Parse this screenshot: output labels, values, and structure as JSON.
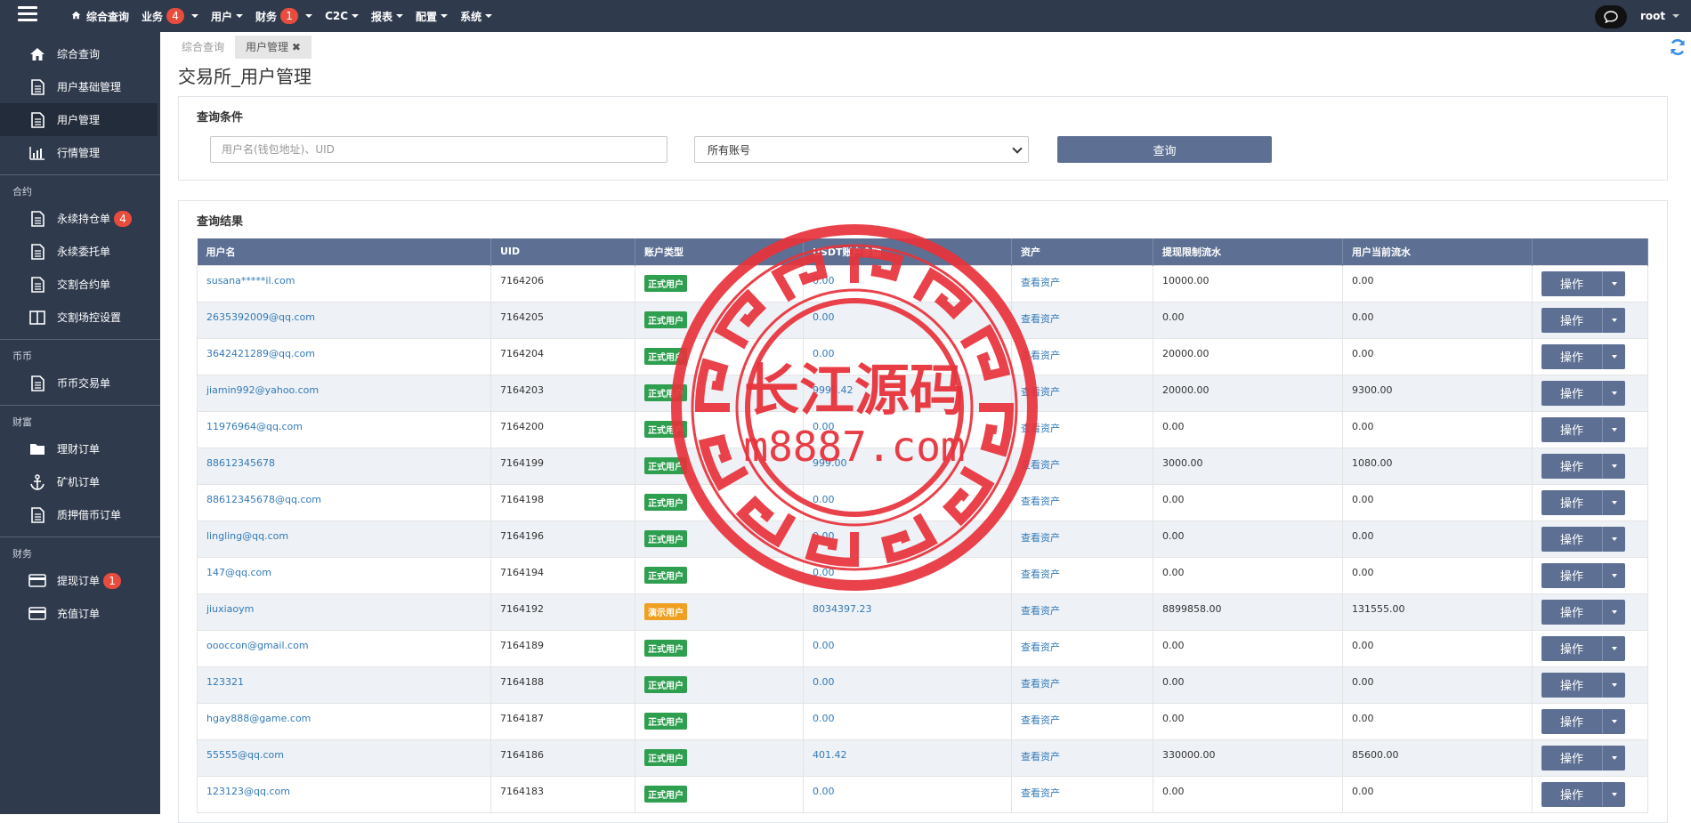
{
  "topbar": {
    "nav": [
      {
        "label": "综合查询",
        "icon": "home-icon"
      },
      {
        "label": "业务",
        "badge": "4",
        "dropdown": true
      },
      {
        "label": "用户",
        "dropdown": true
      },
      {
        "label": "财务",
        "badge": "1",
        "dropdown": true
      },
      {
        "label": "C2C",
        "dropdown": true
      },
      {
        "label": "报表",
        "dropdown": true
      },
      {
        "label": "配置",
        "dropdown": true
      },
      {
        "label": "系统",
        "dropdown": true
      }
    ],
    "user": "root"
  },
  "sidebar": {
    "groups": [
      {
        "title": "",
        "items": [
          {
            "label": "综合查询",
            "icon": "home-icon"
          },
          {
            "label": "用户基础管理",
            "icon": "document-icon"
          },
          {
            "label": "用户管理",
            "icon": "document-icon",
            "active": true
          },
          {
            "label": "行情管理",
            "icon": "bar-chart-icon"
          }
        ]
      },
      {
        "title": "合约",
        "items": [
          {
            "label": "永续持仓单",
            "icon": "document-icon",
            "badge": "4"
          },
          {
            "label": "永续委托单",
            "icon": "document-icon"
          },
          {
            "label": "交割合约单",
            "icon": "document-icon"
          },
          {
            "label": "交割场控设置",
            "icon": "columns-icon"
          }
        ]
      },
      {
        "title": "币币",
        "items": [
          {
            "label": "币币交易单",
            "icon": "document-icon"
          }
        ]
      },
      {
        "title": "财富",
        "items": [
          {
            "label": "理财订单",
            "icon": "folder-icon"
          },
          {
            "label": "矿机订单",
            "icon": "anchor-icon"
          },
          {
            "label": "质押借币订单",
            "icon": "document-icon"
          }
        ]
      },
      {
        "title": "财务",
        "items": [
          {
            "label": "提现订单",
            "icon": "credit-card-icon",
            "badge": "1"
          },
          {
            "label": "充值订单",
            "icon": "credit-card-icon"
          }
        ]
      }
    ]
  },
  "tabs": [
    {
      "label": "综合查询"
    },
    {
      "label": "用户管理 ✖",
      "active": true
    }
  ],
  "page_title": "交易所_用户管理",
  "query": {
    "heading": "查询条件",
    "search_placeholder": "用户名(钱包地址)、UID",
    "account_select": "所有账号",
    "button": "查询"
  },
  "results": {
    "heading": "查询结果",
    "columns": [
      "用户名",
      "UID",
      "账户类型",
      "USDT账户余额",
      "资产",
      "提现限制流水",
      "用户当前流水",
      ""
    ],
    "op_label": "操作",
    "asset_link": "查看资产",
    "rows": [
      {
        "username": "susana*****il.com",
        "uid": "7164206",
        "type": "正式用户",
        "type_color": "green",
        "balance": "0.00",
        "withdraw_limit": "10000.00",
        "current_flow": "0.00"
      },
      {
        "username": "2635392009@qq.com",
        "uid": "7164205",
        "type": "正式用户",
        "type_color": "green",
        "balance": "0.00",
        "withdraw_limit": "0.00",
        "current_flow": "0.00"
      },
      {
        "username": "3642421289@qq.com",
        "uid": "7164204",
        "type": "正式用户",
        "type_color": "green",
        "balance": "0.00",
        "withdraw_limit": "20000.00",
        "current_flow": "0.00"
      },
      {
        "username": "jiamin992@yahoo.com",
        "uid": "7164203",
        "type": "正式用户",
        "type_color": "green",
        "balance": "9999.42",
        "withdraw_limit": "20000.00",
        "current_flow": "9300.00"
      },
      {
        "username": "11976964@qq.com",
        "uid": "7164200",
        "type": "正式用户",
        "type_color": "green",
        "balance": "0.00",
        "withdraw_limit": "0.00",
        "current_flow": "0.00"
      },
      {
        "username": "88612345678",
        "uid": "7164199",
        "type": "正式用户",
        "type_color": "green",
        "balance": "999.00",
        "withdraw_limit": "3000.00",
        "current_flow": "1080.00"
      },
      {
        "username": "88612345678@qq.com",
        "uid": "7164198",
        "type": "正式用户",
        "type_color": "green",
        "balance": "0.00",
        "withdraw_limit": "0.00",
        "current_flow": "0.00"
      },
      {
        "username": "lingling@qq.com",
        "uid": "7164196",
        "type": "正式用户",
        "type_color": "green",
        "balance": "0.00",
        "withdraw_limit": "0.00",
        "current_flow": "0.00"
      },
      {
        "username": "147@qq.com",
        "uid": "7164194",
        "type": "正式用户",
        "type_color": "green",
        "balance": "0.00",
        "withdraw_limit": "0.00",
        "current_flow": "0.00"
      },
      {
        "username": "jiuxiaoym",
        "uid": "7164192",
        "type": "演示用户",
        "type_color": "orange",
        "balance": "8034397.23",
        "withdraw_limit": "8899858.00",
        "current_flow": "131555.00"
      },
      {
        "username": "oooccon@gmail.com",
        "uid": "7164189",
        "type": "正式用户",
        "type_color": "green",
        "balance": "0.00",
        "withdraw_limit": "0.00",
        "current_flow": "0.00"
      },
      {
        "username": "123321",
        "uid": "7164188",
        "type": "正式用户",
        "type_color": "green",
        "balance": "0.00",
        "withdraw_limit": "0.00",
        "current_flow": "0.00"
      },
      {
        "username": "hgay888@game.com",
        "uid": "7164187",
        "type": "正式用户",
        "type_color": "green",
        "balance": "0.00",
        "withdraw_limit": "0.00",
        "current_flow": "0.00"
      },
      {
        "username": "55555@qq.com",
        "uid": "7164186",
        "type": "正式用户",
        "type_color": "green",
        "balance": "401.42",
        "withdraw_limit": "330000.00",
        "current_flow": "85600.00"
      },
      {
        "username": "123123@qq.com",
        "uid": "7164183",
        "type": "正式用户",
        "type_color": "green",
        "balance": "0.00",
        "withdraw_limit": "0.00",
        "current_flow": "0.00"
      }
    ]
  },
  "watermark": {
    "line1": "长江源码",
    "line2": "m8887.com"
  },
  "colors": {
    "nav_bg": "#2f3a4d",
    "accent": "#5d7094",
    "link": "#337ab7",
    "badge": "#e84c3d",
    "green_label": "#2e9e4f",
    "orange_label": "#f0a020",
    "stamp": "#e8333c"
  }
}
